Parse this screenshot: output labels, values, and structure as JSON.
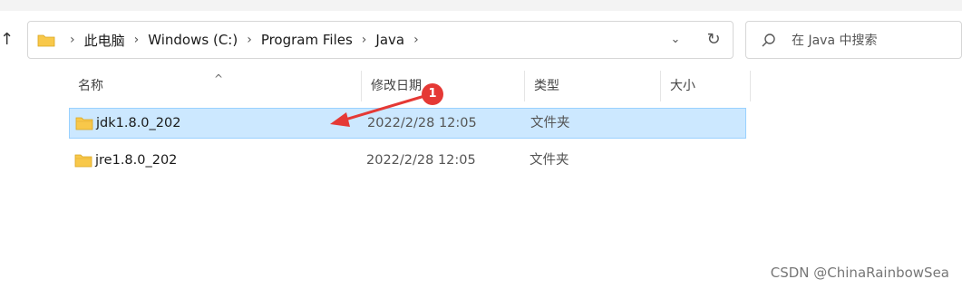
{
  "breadcrumb": [
    "此电脑",
    "Windows (C:)",
    "Program Files",
    "Java"
  ],
  "search": {
    "placeholder": "在 Java 中搜索"
  },
  "columns": {
    "name": "名称",
    "modified": "修改日期",
    "type": "类型",
    "size": "大小"
  },
  "files": [
    {
      "name": "jdk1.8.0_202",
      "modified": "2022/2/28 12:05",
      "type": "文件夹",
      "size": "",
      "selected": true
    },
    {
      "name": "jre1.8.0_202",
      "modified": "2022/2/28 12:05",
      "type": "文件夹",
      "size": "",
      "selected": false
    }
  ],
  "annotation": {
    "badge": "1",
    "color": "#e53935"
  },
  "watermark": "CSDN @ChinaRainbowSea",
  "colors": {
    "selection_bg": "#cce8ff",
    "selection_border": "#99d1ff",
    "folder": "#f8c84a"
  },
  "icons": [
    "up-arrow-icon",
    "folder-icon",
    "chevron-right-icon",
    "chevron-down-icon",
    "refresh-icon",
    "search-icon",
    "sort-up-icon"
  ]
}
